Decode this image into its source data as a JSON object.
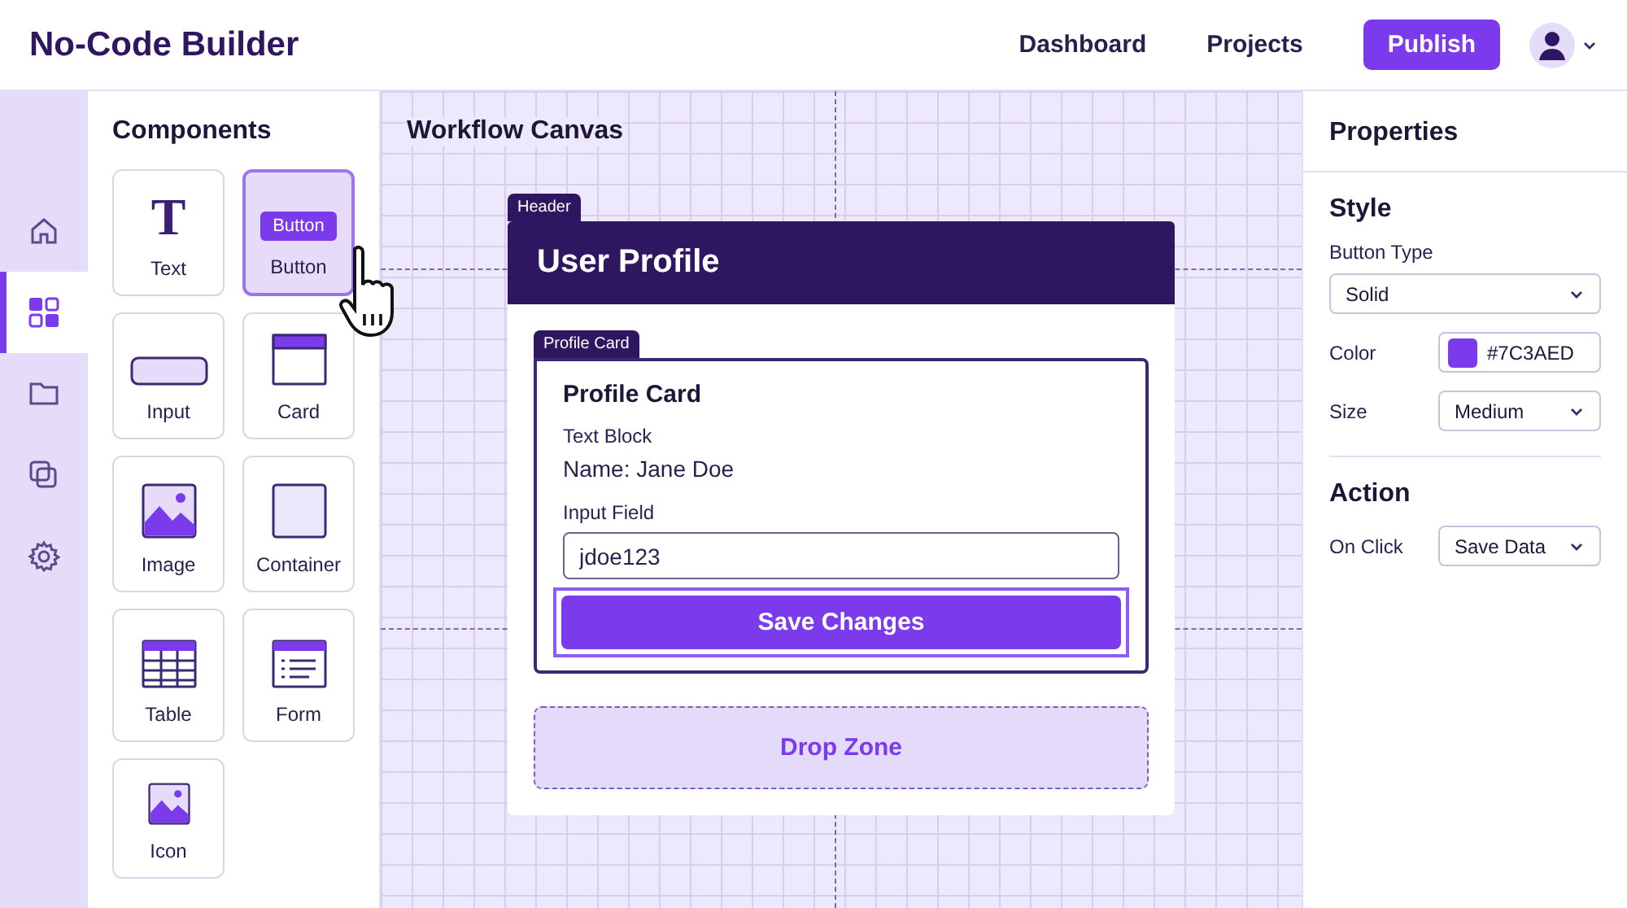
{
  "app": {
    "title": "No-Code Builder"
  },
  "nav": [
    {
      "label": "Dashboard"
    },
    {
      "label": "Projects"
    }
  ],
  "publish_button": "Publish",
  "rail": [
    {
      "kind": "home",
      "selected": false
    },
    {
      "kind": "components",
      "selected": true
    },
    {
      "kind": "folder",
      "selected": false
    },
    {
      "kind": "layers",
      "selected": false
    },
    {
      "kind": "settings",
      "selected": false
    }
  ],
  "components": {
    "title": "Components",
    "items": [
      {
        "kind": "text",
        "glyph": "T",
        "label": "Text",
        "selected": false
      },
      {
        "kind": "button",
        "badge": "Button",
        "label": "Button",
        "selected": true
      },
      {
        "kind": "input",
        "label": "Input",
        "selected": false
      },
      {
        "kind": "card",
        "label": "Card",
        "selected": false
      },
      {
        "kind": "image",
        "label": "Image",
        "selected": false
      },
      {
        "kind": "container",
        "label": "Container",
        "selected": false
      },
      {
        "kind": "table",
        "label": "Table",
        "selected": false
      },
      {
        "kind": "form",
        "label": "Form",
        "selected": false
      },
      {
        "kind": "icon",
        "label": "Icon",
        "selected": false
      }
    ]
  },
  "canvas": {
    "title": "Workflow Canvas",
    "header": {
      "tag": "Header",
      "title": "User Profile"
    },
    "card": {
      "tag": "Profile Card",
      "title": "Profile Card",
      "text_label": "Text Block",
      "text_value": "Name: Jane Doe",
      "input_label": "Input Field",
      "input_value": "jdoe123",
      "button": "Save Changes",
      "button_selected": true
    },
    "drop_zone": "Drop Zone"
  },
  "properties": {
    "title": "Properties",
    "sections": [
      {
        "title": "Style",
        "fields": [
          {
            "kind": "stacked_select",
            "label": "Button Type",
            "value": "Solid"
          },
          {
            "kind": "color",
            "label": "Color",
            "value": "#7C3AED",
            "color": "#7c3aed"
          },
          {
            "kind": "select",
            "label": "Size",
            "value": "Medium"
          }
        ]
      },
      {
        "title": "Action",
        "fields": [
          {
            "kind": "select",
            "label": "On Click",
            "value": "Save Data"
          }
        ]
      }
    ]
  }
}
